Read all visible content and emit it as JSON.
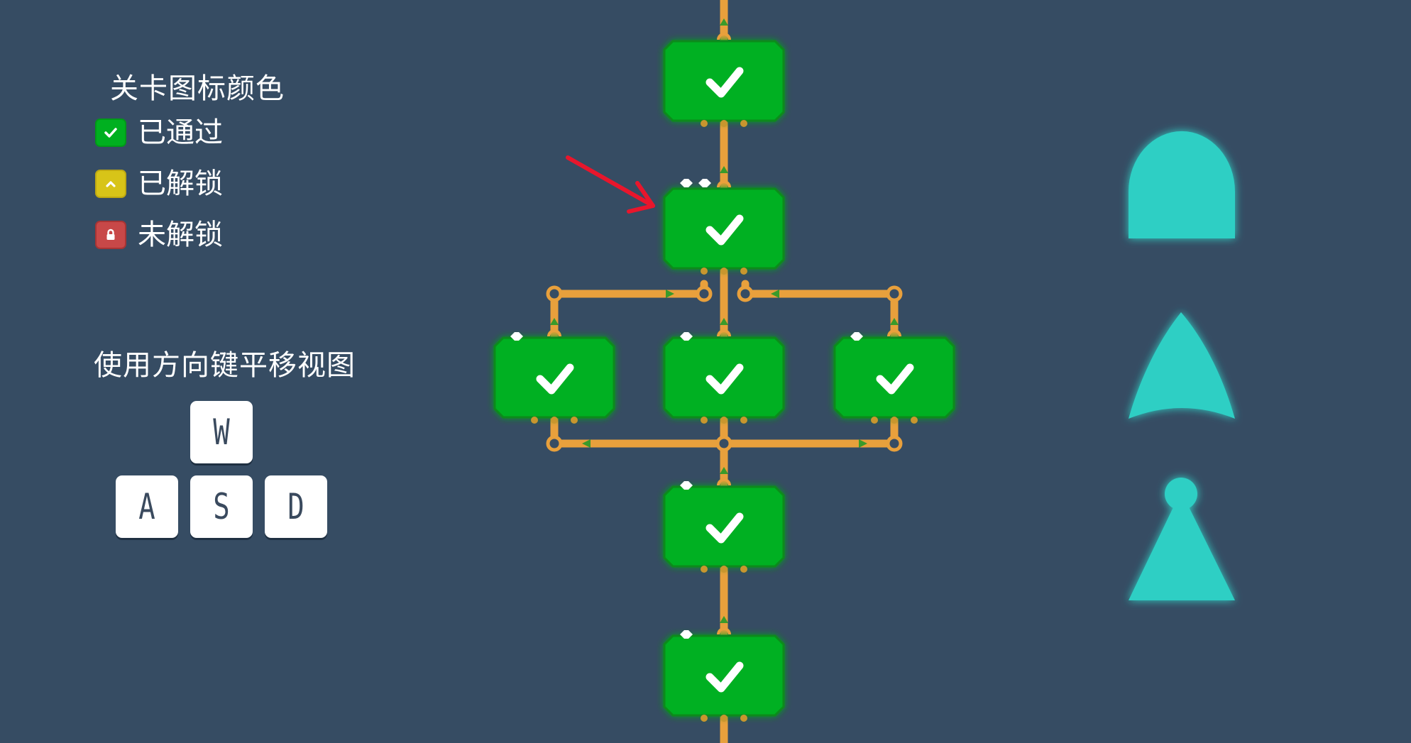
{
  "legend": {
    "title": "关卡图标颜色",
    "items": [
      {
        "label": "已通过",
        "color": "#00b020",
        "border": "#009a18",
        "icon": "check-icon"
      },
      {
        "label": "已解锁",
        "color": "#d8c418",
        "border": "#bfa912",
        "icon": "chevron-up-icon"
      },
      {
        "label": "未解锁",
        "color": "#c84848",
        "border": "#a83434",
        "icon": "lock-icon"
      }
    ]
  },
  "controls": {
    "title": "使用方向键平移视图",
    "keys": {
      "up": "W",
      "left": "A",
      "down": "S",
      "right": "D"
    }
  },
  "colors": {
    "background": "#364c63",
    "level_completed": "#00b020",
    "wire": "#e8a03c",
    "annotation_arrow": "#e8162c",
    "logic_gate_shapes": "#2ecfc4"
  },
  "level_map": {
    "levels": [
      {
        "id": "level-1",
        "status": "completed",
        "indicator_dots": 0
      },
      {
        "id": "level-2",
        "status": "completed",
        "indicator_dots": 2
      },
      {
        "id": "level-3a",
        "status": "completed",
        "indicator_dots": 1
      },
      {
        "id": "level-3b",
        "status": "completed",
        "indicator_dots": 1
      },
      {
        "id": "level-3c",
        "status": "completed",
        "indicator_dots": 1
      },
      {
        "id": "level-4",
        "status": "completed",
        "indicator_dots": 1
      },
      {
        "id": "level-5",
        "status": "completed",
        "indicator_dots": 1
      }
    ]
  },
  "side_shapes": [
    "and-gate-icon",
    "or-gate-icon",
    "not-gate-icon"
  ]
}
